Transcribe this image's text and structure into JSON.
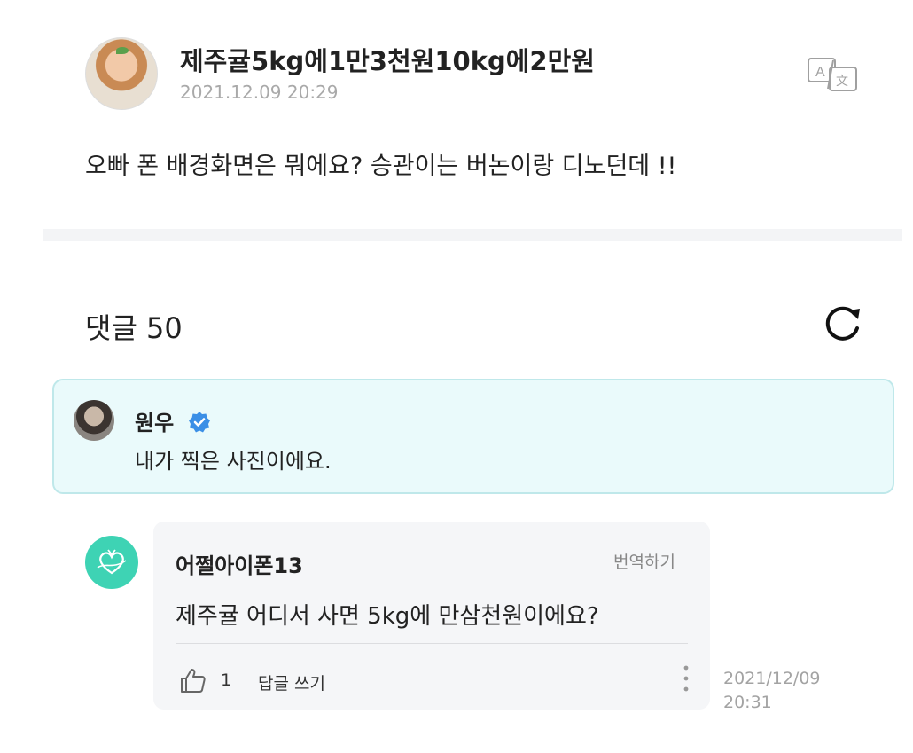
{
  "post": {
    "author": "제주귤5kg에1만3천원10kg에2만원",
    "timestamp": "2021.12.09 20:29",
    "body": "오빠 폰 배경화면은 뭐에요? 승관이는 버논이랑 디노던데 !!"
  },
  "comments": {
    "heading": "댓글 50",
    "refresh_icon": "refresh-icon"
  },
  "highlight": {
    "author": "원우",
    "verified_icon": "verified-badge-icon",
    "text": "내가 찍은 사진이에요."
  },
  "comment": {
    "author": "어쩔아이폰13",
    "translate_label": "번역하기",
    "text": "제주귤 어디서 사면 5kg에 만삼천원이에요?",
    "like_count": "1",
    "reply_label": "답글 쓰기",
    "timestamp_date": "2021/12/09",
    "timestamp_time": "20:31"
  },
  "colors": {
    "highlight_bg": "#eafafb",
    "highlight_border": "#bfe8ea",
    "verified_blue": "#3b8fe6",
    "commenter_avatar": "#3ed3b4",
    "comment_bg": "#f5f6f8"
  }
}
